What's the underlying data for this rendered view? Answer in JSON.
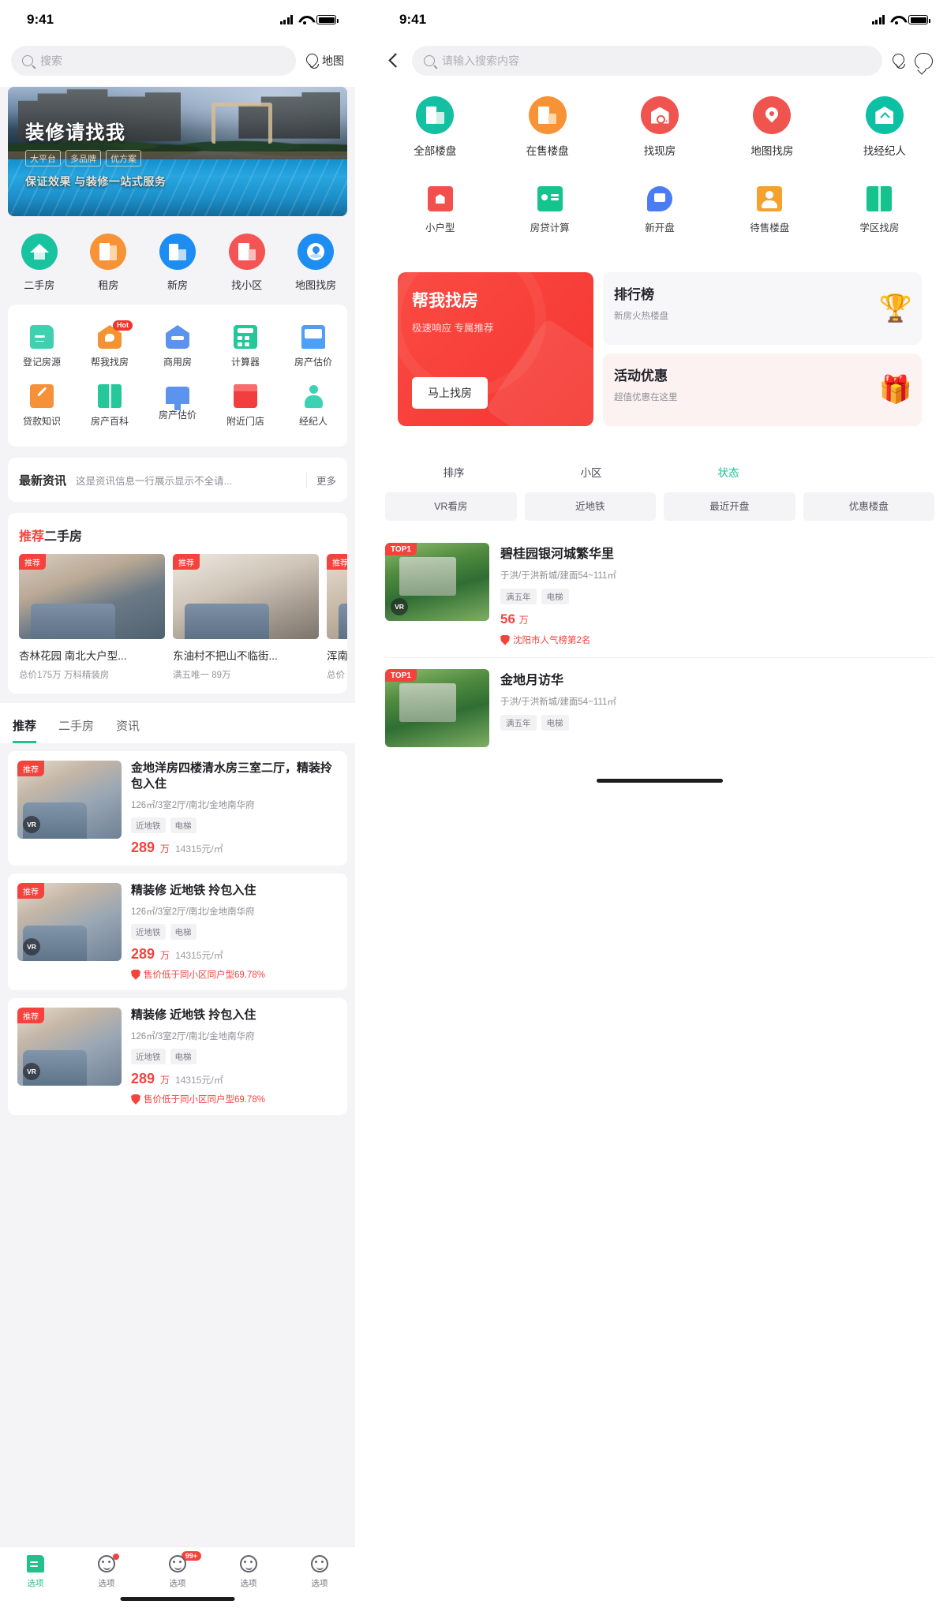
{
  "status_bar": {
    "time": "9:41"
  },
  "left": {
    "search": {
      "placeholder": "搜索",
      "icon": "search-icon"
    },
    "map_button": {
      "label": "地图",
      "icon": "map-pin-icon"
    },
    "banner": {
      "title": "装修请找我",
      "tags": [
        "大平台",
        "多品牌",
        "优方案"
      ],
      "subtitle": "保证效果 与装修一站式服务"
    },
    "categories": [
      {
        "label": "二手房",
        "color": "#18c3a0",
        "icon": "home-icon"
      },
      {
        "label": "租房",
        "color": "#f89236",
        "icon": "door-icon"
      },
      {
        "label": "新房",
        "color": "#1d8df2",
        "icon": "building-icon"
      },
      {
        "label": "找小区",
        "color": "#f55454",
        "icon": "document-icon"
      },
      {
        "label": "地图找房",
        "color": "#1d8df2",
        "icon": "location-icon"
      }
    ],
    "services_row1": [
      {
        "label": "登记房源",
        "icon": "file-icon",
        "badge": ""
      },
      {
        "label": "帮我找房",
        "icon": "house-chat-icon",
        "badge": "Hot"
      },
      {
        "label": "商用房",
        "icon": "house-bed-icon",
        "badge": ""
      },
      {
        "label": "计算器",
        "icon": "calculator-icon",
        "badge": ""
      },
      {
        "label": "房产估价",
        "icon": "monitor-icon",
        "badge": ""
      }
    ],
    "services_row2": [
      {
        "label": "贷款知识",
        "icon": "pencil-icon",
        "badge": ""
      },
      {
        "label": "房产百科",
        "icon": "book-icon",
        "badge": ""
      },
      {
        "label": "房产估价",
        "icon": "chart-monitor-icon",
        "badge": ""
      },
      {
        "label": "附近门店",
        "icon": "shop-icon",
        "badge": ""
      },
      {
        "label": "经纪人",
        "icon": "agent-icon",
        "badge": ""
      }
    ],
    "news": {
      "title": "最新资讯",
      "content": "这是资讯信息一行展示显示不全请...",
      "more": "更多"
    },
    "recommend": {
      "title_accent": "推荐",
      "title_rest": "二手房",
      "cards": [
        {
          "badge": "推荐",
          "title": "杏林花园 南北大户型...",
          "sub": "总价175万 万科精装房"
        },
        {
          "badge": "推荐",
          "title": "东油村不把山不临街...",
          "sub": "满五唯一 89万"
        },
        {
          "badge": "推荐",
          "title": "浑南",
          "sub": "总价"
        }
      ]
    },
    "tabs": [
      {
        "label": "推荐",
        "active": true
      },
      {
        "label": "二手房",
        "active": false
      },
      {
        "label": "资讯",
        "active": false
      }
    ],
    "listings": [
      {
        "badge": "推荐",
        "vr": "VR",
        "title": "金地洋房四楼清水房三室二厅，精装拎包入住",
        "spec": "126㎡/3室2厅/南北/金地南华府",
        "tags": [
          "近地铁",
          "电梯"
        ],
        "price": "289",
        "unit": "万",
        "per": "14315元/㎡",
        "note": ""
      },
      {
        "badge": "推荐",
        "vr": "VR",
        "title": "精装修 近地铁 拎包入住",
        "spec": "126㎡/3室2厅/南北/金地南华府",
        "tags": [
          "近地铁",
          "电梯"
        ],
        "price": "289",
        "unit": "万",
        "per": "14315元/㎡",
        "note": "售价低于同小区同户型69.78%"
      },
      {
        "badge": "推荐",
        "vr": "VR",
        "title": "精装修 近地铁 拎包入住",
        "spec": "126㎡/3室2厅/南北/金地南华府",
        "tags": [
          "近地铁",
          "电梯"
        ],
        "price": "289",
        "unit": "万",
        "per": "14315元/㎡",
        "note": "售价低于同小区同户型69.78%"
      }
    ],
    "tabbar": [
      {
        "label": "选项",
        "icon": "doc-icon",
        "active": true,
        "dot": false,
        "count": ""
      },
      {
        "label": "选项",
        "icon": "face-icon",
        "active": false,
        "dot": true,
        "count": ""
      },
      {
        "label": "选项",
        "icon": "face-icon",
        "active": false,
        "dot": false,
        "count": "99+"
      },
      {
        "label": "选项",
        "icon": "face-icon",
        "active": false,
        "dot": false,
        "count": ""
      },
      {
        "label": "选项",
        "icon": "face-icon",
        "active": false,
        "dot": false,
        "count": ""
      }
    ]
  },
  "right": {
    "back": {
      "icon": "chevron-left-icon"
    },
    "search": {
      "placeholder": "请输入搜索内容",
      "icon": "search-icon"
    },
    "map_icon": "map-pin-icon",
    "chat_icon": "chat-bubble-icon",
    "categories": [
      {
        "label": "全部楼盘",
        "color": "#15c0a2",
        "icon": "building-icon"
      },
      {
        "label": "在售楼盘",
        "color": "#f89236",
        "icon": "document-icon"
      },
      {
        "label": "找现房",
        "color": "#f0544f",
        "icon": "house-key-icon"
      },
      {
        "label": "地图找房",
        "color": "#f0544f",
        "icon": "location-pin-icon"
      },
      {
        "label": "找经纪人",
        "color": "#0cc0a3",
        "icon": "house-arrow-icon"
      }
    ],
    "services": [
      {
        "label": "小户型",
        "icon": "small-house-icon"
      },
      {
        "label": "房贷计算",
        "icon": "loan-calc-icon"
      },
      {
        "label": "新开盘",
        "icon": "new-open-icon"
      },
      {
        "label": "待售楼盘",
        "icon": "pending-sale-icon"
      },
      {
        "label": "学区找房",
        "icon": "school-district-icon"
      }
    ],
    "promo": {
      "main": {
        "title": "帮我找房",
        "subtitle": "极速响应 专属推荐",
        "button": "马上找房"
      },
      "rank": {
        "title": "排行榜",
        "subtitle": "新房火热楼盘",
        "emoji": "🏆"
      },
      "activity": {
        "title": "活动优惠",
        "subtitle": "超值优惠在这里",
        "emoji": "🎁"
      }
    },
    "filters": [
      {
        "label": "排序",
        "active": false,
        "arrow": true
      },
      {
        "label": "小区",
        "active": false,
        "arrow": false
      },
      {
        "label": "状态",
        "active": true,
        "arrow": true
      }
    ],
    "chips": [
      "VR看房",
      "近地铁",
      "最近开盘",
      "优惠楼盘"
    ],
    "listings": [
      {
        "rank": "TOP1",
        "vr": "VR",
        "title": "碧桂园银河城繁华里",
        "spec": "于洪/于洪新城/建面54~111㎡",
        "tags": [
          "满五年",
          "电梯"
        ],
        "price": "56",
        "unit": "万",
        "note": "沈阳市人气榜第2名"
      },
      {
        "rank": "TOP1",
        "vr": "",
        "title": "金地月访华",
        "spec": "于洪/于洪新城/建面54~111㎡",
        "tags": [
          "满五年",
          "电梯"
        ],
        "price": "",
        "unit": "",
        "note": ""
      }
    ]
  }
}
